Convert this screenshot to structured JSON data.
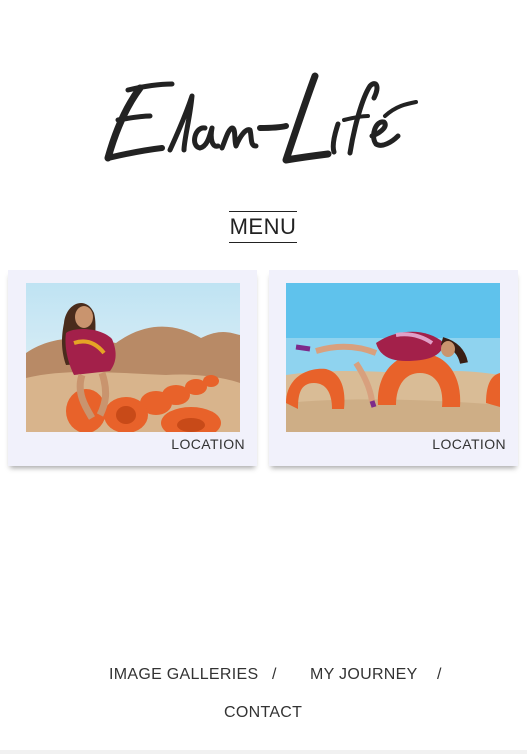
{
  "logo": {
    "text": "Elan-Life"
  },
  "menu": {
    "label": "MENU"
  },
  "galleries": [
    {
      "caption": "LOCATION"
    },
    {
      "caption": "LOCATION"
    }
  ],
  "footer": {
    "links": [
      "IMAGE GALLERIES",
      "MY JOURNEY",
      "CONTACT"
    ],
    "separator": "/"
  },
  "colors": {
    "background": "#ffffff",
    "card_bg": "#f1f1fb",
    "text": "#333333",
    "tire_orange": "#e8622a",
    "sky_blue": "#5fc2ec"
  }
}
